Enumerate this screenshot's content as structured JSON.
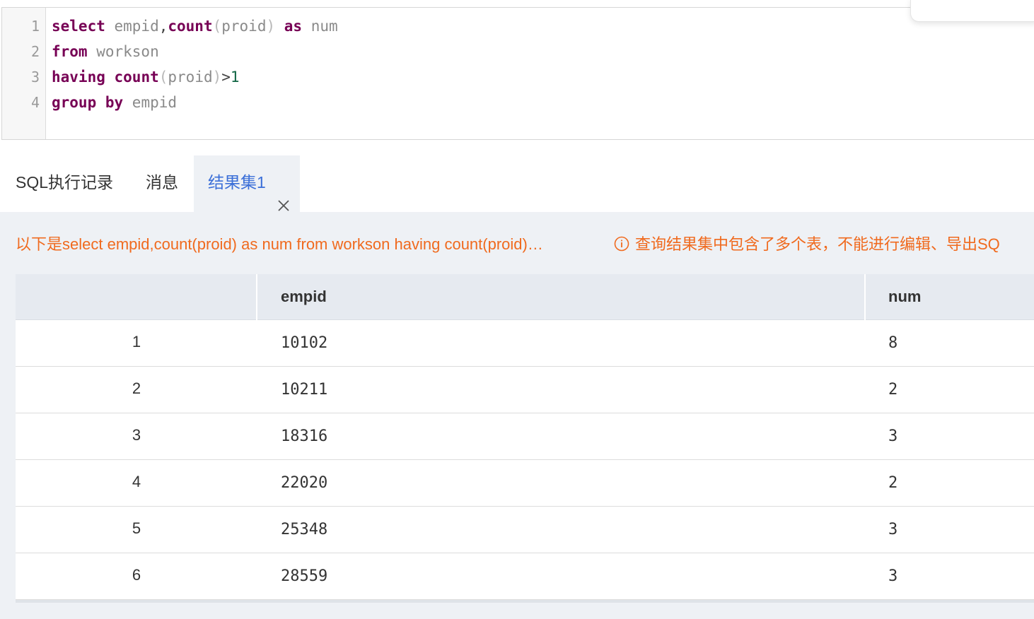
{
  "editor": {
    "line_numbers": [
      "1",
      "2",
      "3",
      "4"
    ],
    "lines": [
      [
        "select",
        " empid",
        ",",
        "count",
        "(",
        "proid",
        ")",
        " ",
        "as",
        " num"
      ],
      [
        "from",
        " workson"
      ],
      [
        "having",
        " ",
        "count",
        "(",
        "proid",
        ")",
        ">",
        "1"
      ],
      [
        "group by",
        " empid"
      ]
    ]
  },
  "tabs": {
    "history": "SQL执行记录",
    "messages": "消息",
    "result": "结果集1"
  },
  "result": {
    "sql_summary": "以下是select empid,count(proid) as num from workson having count(proid)…",
    "warning": "查询结果集中包含了多个表，不能进行编辑、导出SQ",
    "columns": [
      "",
      "empid",
      "num"
    ],
    "rows": [
      {
        "index": "1",
        "empid": "10102",
        "num": "8"
      },
      {
        "index": "2",
        "empid": "10211",
        "num": "2"
      },
      {
        "index": "3",
        "empid": "18316",
        "num": "3"
      },
      {
        "index": "4",
        "empid": "22020",
        "num": "2"
      },
      {
        "index": "5",
        "empid": "25348",
        "num": "3"
      },
      {
        "index": "6",
        "empid": "28559",
        "num": "3"
      }
    ]
  },
  "colors": {
    "keyword": "#770055",
    "active_tab": "#3b6fd8",
    "warning": "#f06a1e"
  }
}
